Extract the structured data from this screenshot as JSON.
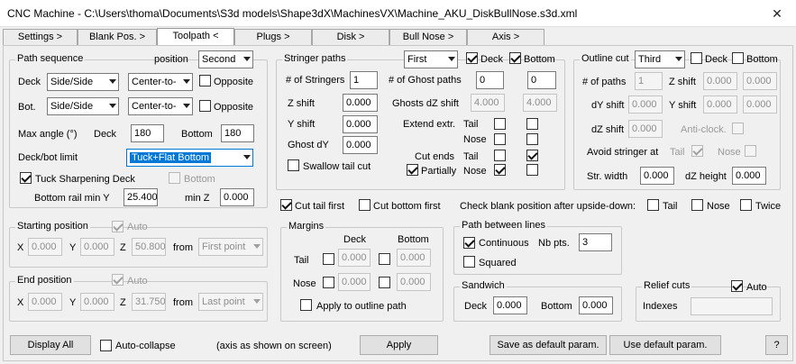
{
  "window": {
    "title": "CNC Machine - C:\\Users\\thoma\\Documents\\S3d models\\Shape3dX\\MachinesVX\\Machine_AKU_DiskBullNose.s3d.xml",
    "close": "✕"
  },
  "tabs": [
    "Settings >",
    "Blank Pos. >",
    "Toolpath <",
    "Plugs >",
    "Disk >",
    "Bull Nose >",
    "Axis >"
  ],
  "path_sequence": {
    "label": "Path sequence",
    "position_label": "position",
    "position_value": "Second",
    "deck_label": "Deck",
    "deck_sel1": "Side/Side",
    "deck_sel2": "Center-to-",
    "opposite_label": "Opposite",
    "bot_label": "Bot.",
    "bot_sel1": "Side/Side",
    "bot_sel2": "Center-to-",
    "opposite2_label": "Opposite",
    "max_angle_label": "Max angle (°)",
    "deck2_label": "Deck",
    "deck_angle": "180",
    "bottom_label": "Bottom",
    "bottom_angle": "180",
    "limit_label": "Deck/bot limit",
    "limit_value": "Tuck+Flat Bottom",
    "tuck_label": "Tuck Sharpening Deck",
    "bottom_cb_label": "Bottom",
    "rail_label": "Bottom rail min Y",
    "rail_value": "25.400",
    "minz_label": "min Z",
    "minz_value": "0.000"
  },
  "stringer": {
    "label": "Stringer paths",
    "sel": "First",
    "deck_label": "Deck",
    "bottom_label": "Bottom",
    "num_label": "# of Stringers",
    "num_value": "1",
    "ghost_label": "# of Ghost paths",
    "ghost_v1": "0",
    "ghost_v2": "0",
    "zshift_label": "Z shift",
    "zshift_value": "0.000",
    "ghostdz_label": "Ghosts dZ shift",
    "ghostdz_v1": "4.000",
    "ghostdz_v2": "4.000",
    "yshift_label": "Y shift",
    "yshift_value": "0.000",
    "extend_label": "Extend extr.",
    "tail_label": "Tail",
    "nose_label": "Nose",
    "ghostdy_label": "Ghost dY",
    "ghostdy_value": "0.000",
    "cutends_label": "Cut ends",
    "tail2_label": "Tail",
    "partially_label": "Partially",
    "nose2_label": "Nose",
    "swallow_label": "Swallow tail cut"
  },
  "outline": {
    "label": "Outline cut",
    "sel": "Third",
    "deck_label": "Deck",
    "bottom_label": "Bottom",
    "paths_label": "# of paths",
    "paths_value": "1",
    "zshift_label": "Z shift",
    "zshift_v1": "0.000",
    "zshift_v2": "0.000",
    "dyshift_label": "dY shift",
    "dyshift_value": "0.000",
    "yshift_label": "Y shift",
    "yshift_v1": "0.000",
    "yshift_v2": "0.000",
    "dzshift_label": "dZ shift",
    "dzshift_value": "0.000",
    "anticlock_label": "Anti-clock.",
    "avoid_label": "Avoid stringer at",
    "tail_label": "Tail",
    "nose_label": "Nose",
    "strwidth_label": "Str. width",
    "strwidth_value": "0.000",
    "dzheight_label": "dZ height",
    "dzheight_value": "0.000"
  },
  "cuts": {
    "tail_first": "Cut tail first",
    "bottom_first": "Cut bottom first",
    "check_label": "Check blank position after upside-down:",
    "tail": "Tail",
    "nose": "Nose",
    "twice": "Twice"
  },
  "starting": {
    "label": "Starting position",
    "auto_label": "Auto",
    "x_label": "X",
    "x": "0.000",
    "y_label": "Y",
    "y": "0.000",
    "z_label": "Z",
    "z": "50.800",
    "from_label": "from",
    "from": "First point"
  },
  "end": {
    "label": "End position",
    "auto_label": "Auto",
    "x_label": "X",
    "x": "0.000",
    "y_label": "Y",
    "y": "0.000",
    "z_label": "Z",
    "z": "31.750",
    "from_label": "from",
    "from": "Last point"
  },
  "margins": {
    "label": "Margins",
    "deck_label": "Deck",
    "bottom_label": "Bottom",
    "tail_label": "Tail",
    "tail_deck": "0.000",
    "tail_bottom": "0.000",
    "nose_label": "Nose",
    "nose_deck": "0.000",
    "nose_bottom": "0.000",
    "apply_label": "Apply to outline path"
  },
  "path_between": {
    "label": "Path between lines",
    "continuous_label": "Continuous",
    "nbpts_label": "Nb pts.",
    "nbpts_value": "3",
    "squared_label": "Squared"
  },
  "sandwich": {
    "label": "Sandwich",
    "deck_label": "Deck",
    "deck_value": "0.000",
    "bottom_label": "Bottom",
    "bottom_value": "0.000"
  },
  "relief": {
    "label": "Relief cuts",
    "auto_label": "Auto",
    "indexes_label": "Indexes",
    "indexes_value": ""
  },
  "footer": {
    "display_all": "Display All",
    "auto_collapse": "Auto-collapse",
    "axis_note": "(axis as shown on screen)",
    "apply": "Apply",
    "save_default": "Save as default param.",
    "use_default": "Use default param.",
    "help": "?"
  },
  "colors": {
    "accent": "#0078d7",
    "window_bg": "#f0f0f0"
  }
}
